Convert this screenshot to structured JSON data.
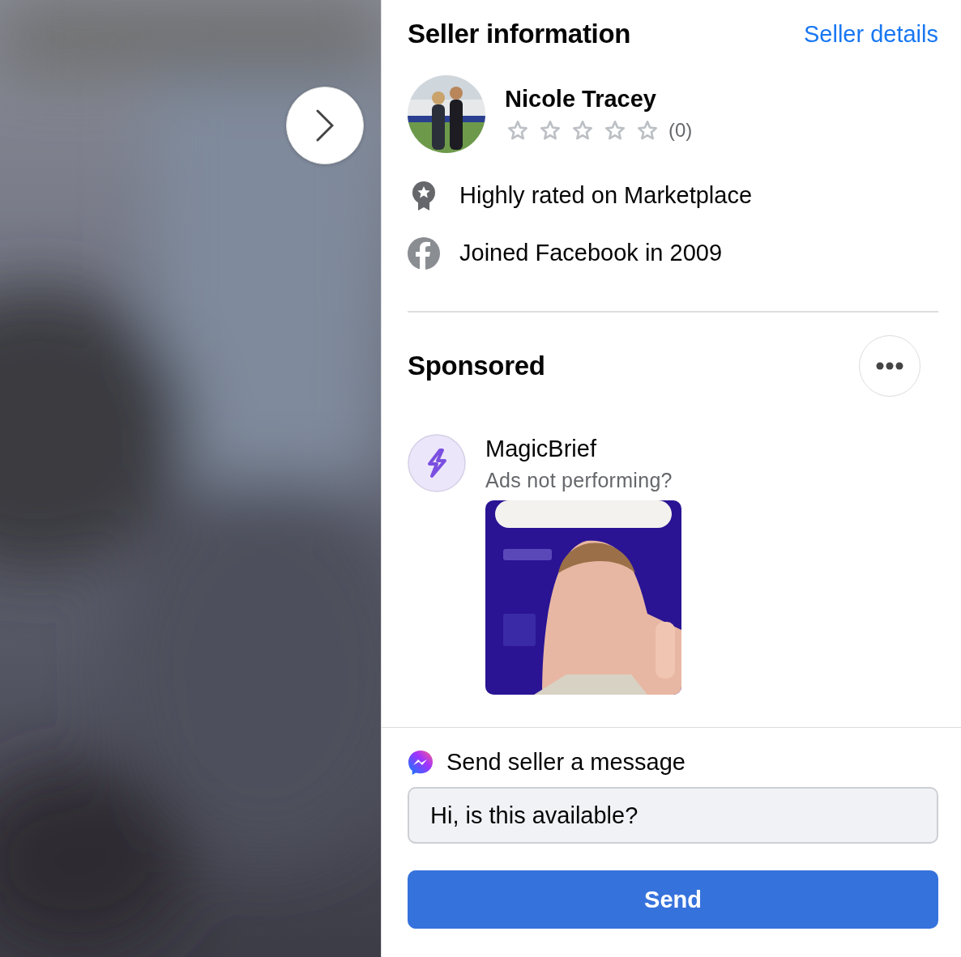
{
  "seller": {
    "title": "Seller information",
    "details_link": "Seller details",
    "name": "Nicole Tracey",
    "stars": 0,
    "rating_count": "(0)",
    "facts": [
      {
        "kind": "badge",
        "text": "Highly rated on Marketplace"
      },
      {
        "kind": "facebook",
        "text": "Joined Facebook in 2009"
      }
    ]
  },
  "sponsored": {
    "title": "Sponsored",
    "ad": {
      "name": "MagicBrief",
      "tagline": "Ads not performing?"
    }
  },
  "message": {
    "title": "Send seller a message",
    "value": "Hi, is this available?",
    "button": "Send"
  }
}
